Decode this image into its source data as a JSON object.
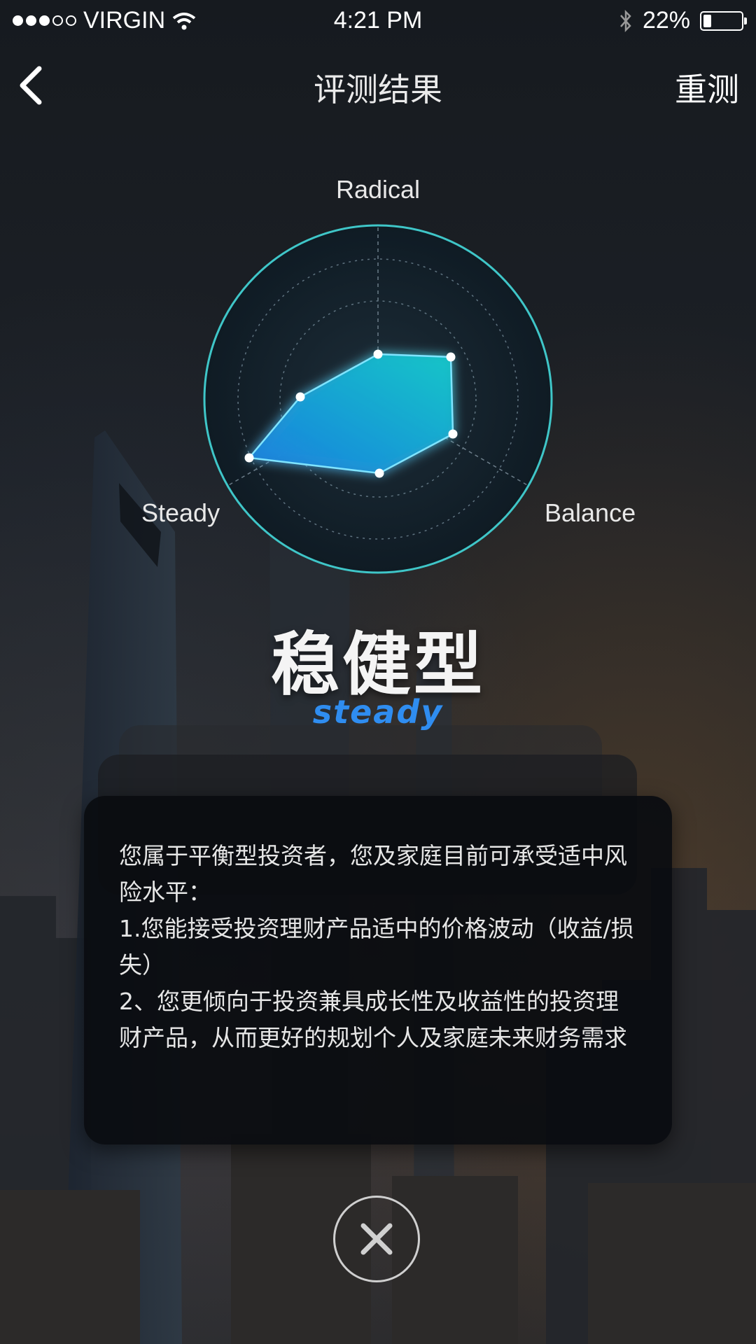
{
  "status_bar": {
    "carrier": "VIRGIN",
    "time": "4:21 PM",
    "battery_percent": "22%",
    "battery_level": 0.22,
    "signal_bars_filled": 3,
    "signal_bars_total": 5,
    "icons": [
      "wifi-icon",
      "bluetooth-icon",
      "battery-icon"
    ]
  },
  "nav": {
    "back_icon": "chevron-left-icon",
    "title": "评测结果",
    "retest_label": "重测"
  },
  "chart_data": {
    "type": "radar",
    "axes": [
      "Radical",
      "Balance",
      "Steady"
    ],
    "polygon_color": "#1fb6e6",
    "ring_color": "#3fc6c8"
  },
  "result": {
    "title": "稳健型",
    "subtitle": "steady",
    "subtitle_color": "#2f8df0"
  },
  "description": {
    "lines": [
      "您属于平衡型投资者，您及家庭目前可承受适中风险水平：",
      "1.您能接受投资理财产品适中的价格波动（收益/损失）",
      "2、您更倾向于投资兼具成长性及收益性的投资理财产品，从而更好的规划个人及家庭未来财务需求"
    ]
  },
  "close_icon": "close-icon"
}
